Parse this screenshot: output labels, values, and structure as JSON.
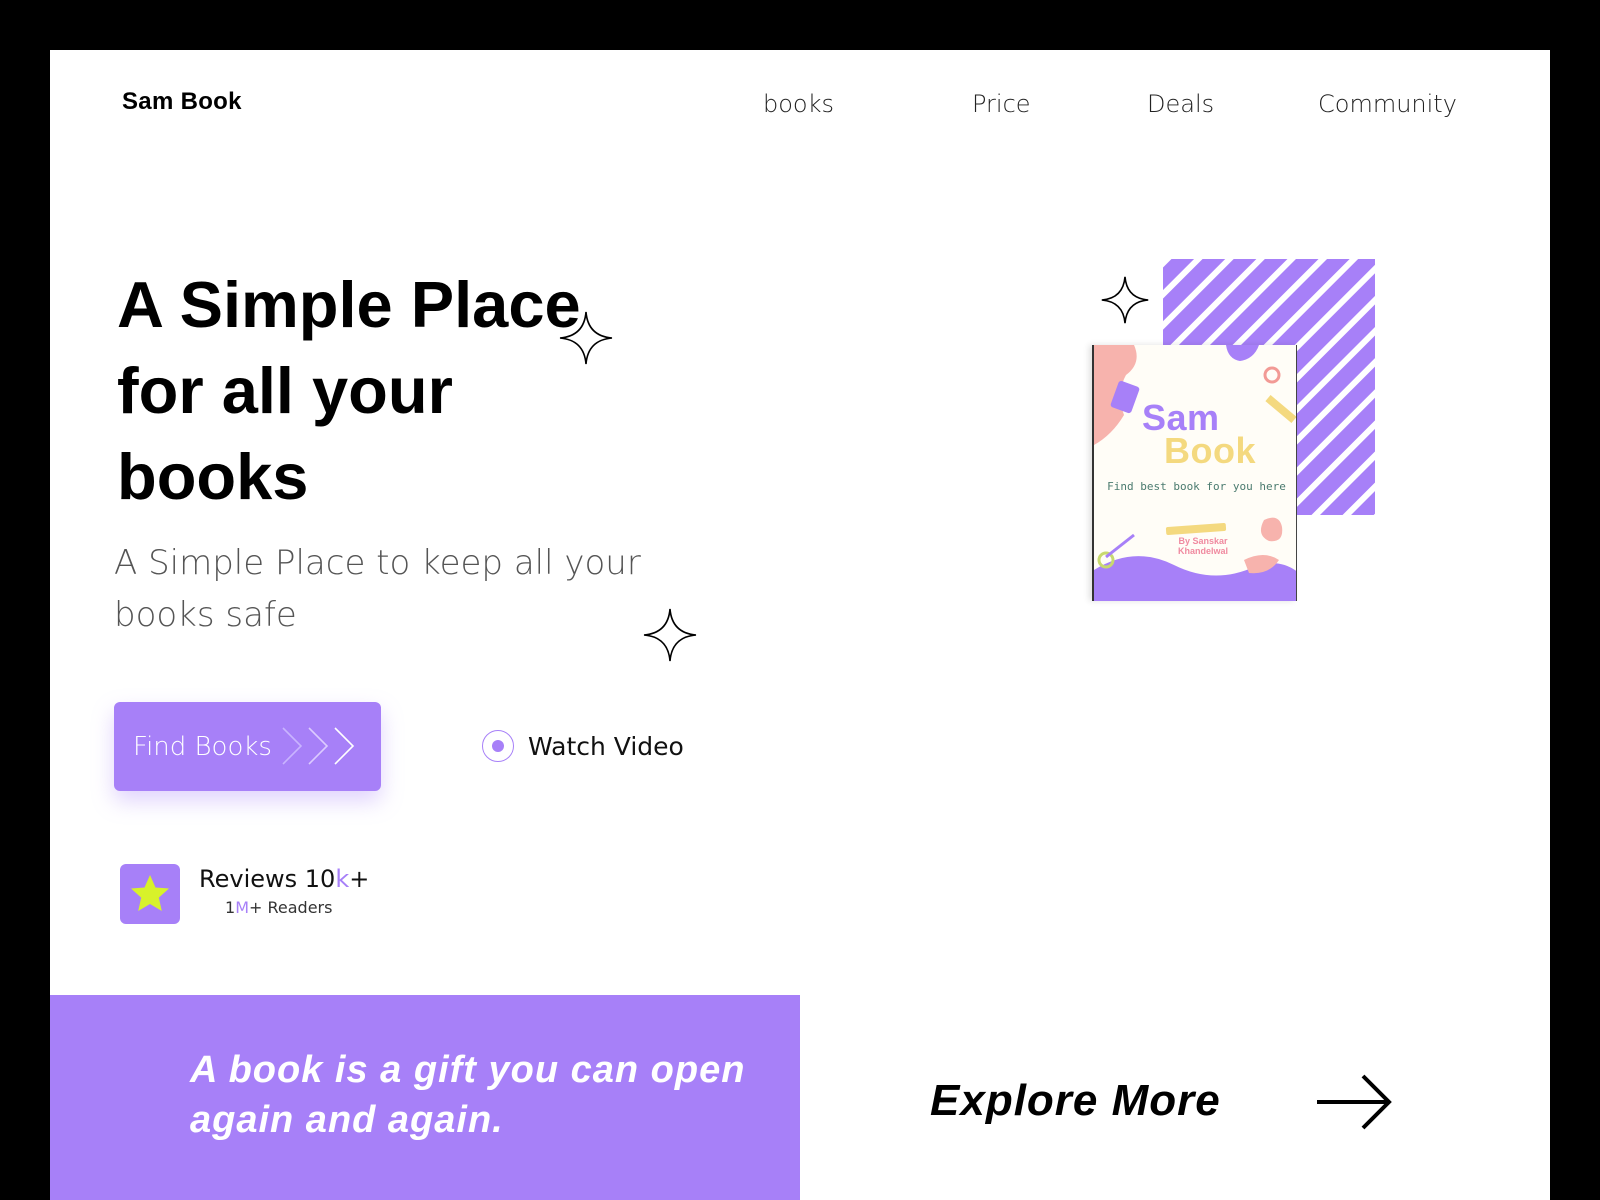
{
  "header": {
    "brand": "Sam Book",
    "nav": [
      "books",
      "Price",
      "Deals",
      "Community"
    ]
  },
  "hero": {
    "title": "A Simple Place for all your books",
    "subtitle": "A Simple Place to keep all your books safe"
  },
  "actions": {
    "find_books": "Find Books",
    "watch_video": "Watch Video"
  },
  "reviews": {
    "title_prefix": "Reviews 10",
    "title_accent": "k",
    "title_suffix": "+",
    "sub_prefix": "1",
    "sub_accent": "M",
    "sub_suffix": "+ Readers"
  },
  "quote": "A book is a gift you can open again and again.",
  "explore": "Explore More",
  "book_cover": {
    "title_line1": "Sam",
    "title_line2": "Book",
    "tagline": "Find best book for you here",
    "author": "By Sanskar Khandelwal"
  },
  "colors": {
    "accent": "#a780f8",
    "star": "#d8f22a",
    "background": "#ffffff",
    "frame": "#000000"
  },
  "icons": [
    "sparkle-icon",
    "chevrons-right-icon",
    "radio-play-icon",
    "star-icon",
    "arrow-right-icon"
  ]
}
